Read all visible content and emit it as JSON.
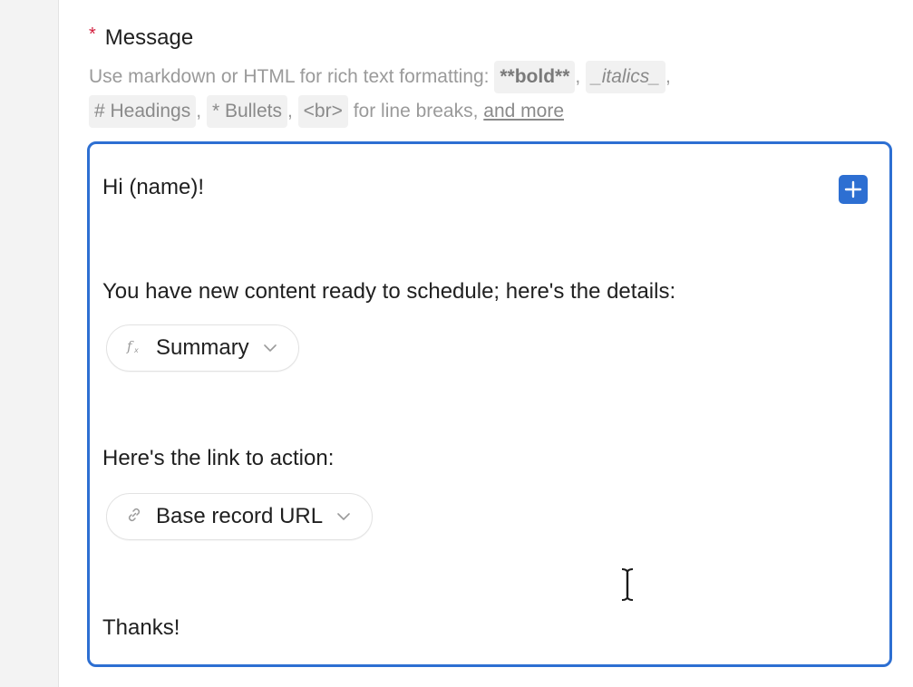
{
  "field": {
    "required_marker": "*",
    "label": "Message"
  },
  "help": {
    "prefix": "Use markdown or HTML for rich text formatting:",
    "bold_code": "**bold**",
    "italics_code": "_italics_",
    "headings_code": "# Headings",
    "bullets_code": "* Bullets",
    "br_code": "<br>",
    "line_breaks_text": "for line breaks,",
    "more_link": "and more",
    "comma": ","
  },
  "editor": {
    "line1": "Hi (name)!",
    "line2": "You have new content ready to schedule; here's the details:",
    "token1_label": "Summary",
    "token1_icon": "formula-icon",
    "line3": "Here's the link to action:",
    "token2_label": "Base record URL",
    "token2_icon": "link-icon",
    "line4": "Thanks!",
    "insert_icon": "plus-icon"
  },
  "colors": {
    "accent": "#2d6fd2",
    "required": "#d3203f"
  }
}
